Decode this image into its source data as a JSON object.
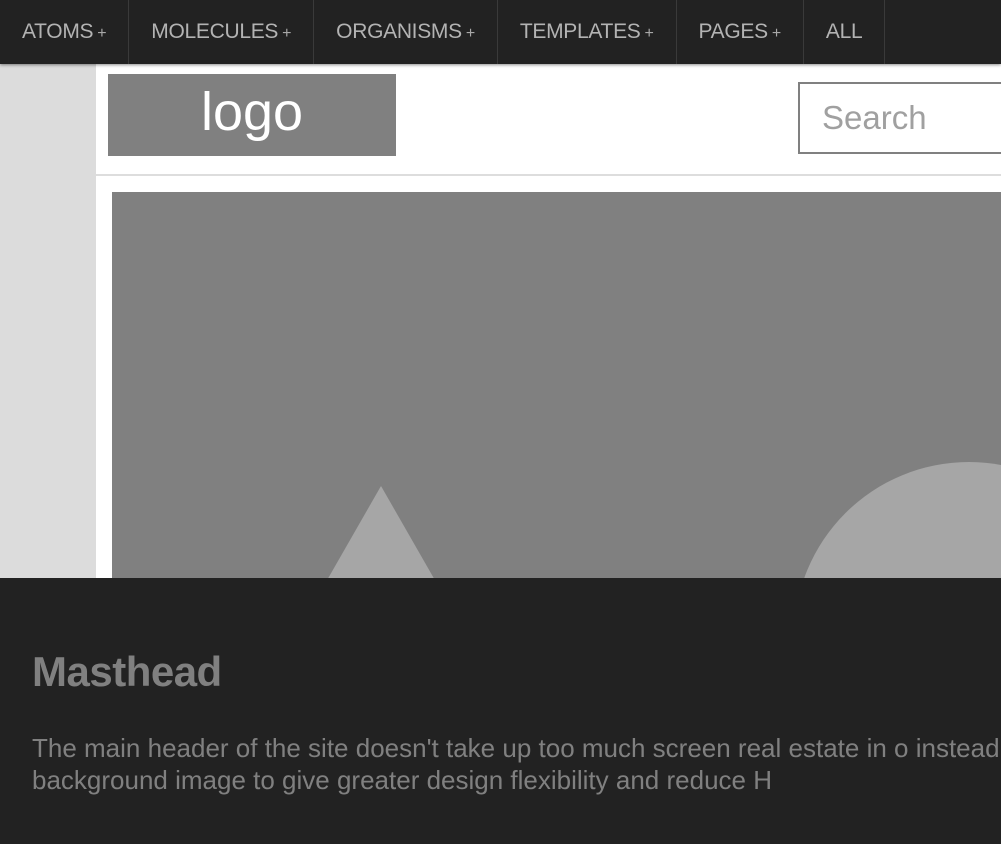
{
  "nav": {
    "items": [
      {
        "label": "ATOMS",
        "has_submenu": true
      },
      {
        "label": "MOLECULES",
        "has_submenu": true
      },
      {
        "label": "ORGANISMS",
        "has_submenu": true
      },
      {
        "label": "TEMPLATES",
        "has_submenu": true
      },
      {
        "label": "PAGES",
        "has_submenu": true
      },
      {
        "label": "ALL",
        "has_submenu": false
      }
    ],
    "submenu_glyph": "+"
  },
  "header": {
    "logo_text": "logo",
    "search_placeholder": "Search"
  },
  "hero": {
    "shapes": [
      "mountain-triangle",
      "sun-circle"
    ]
  },
  "annotation": {
    "title": "Masthead",
    "description": "The main header of the site doesn't take up too much screen real estate in o instead of a background image to give greater design flexibility and reduce H"
  },
  "colors": {
    "nav_bg": "#222222",
    "nav_text": "#b3b3b3",
    "placeholder_gray": "#808080",
    "shape_gray": "#a6a6a6",
    "annotation_text": "#808080"
  }
}
